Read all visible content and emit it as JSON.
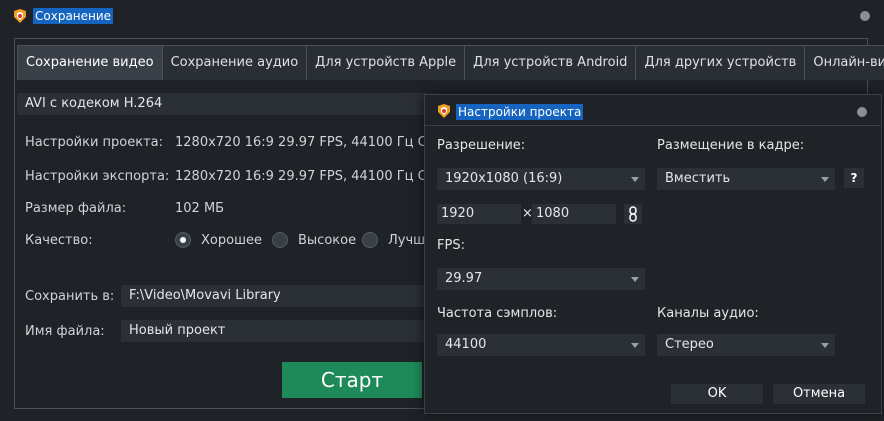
{
  "window": {
    "title": "Сохранение",
    "icon": "movavi-logo-icon"
  },
  "tabs": [
    {
      "label": "Сохранение видео",
      "active": true
    },
    {
      "label": "Сохранение аудио",
      "active": false
    },
    {
      "label": "Для устройств Apple",
      "active": false
    },
    {
      "label": "Для устройств Android",
      "active": false
    },
    {
      "label": "Для других устройств",
      "active": false
    },
    {
      "label": "Онлайн-видео",
      "active": false
    }
  ],
  "format": {
    "value": "AVI с кодеком H.264"
  },
  "rows": {
    "project_label": "Настройки проекта:",
    "project_value": "1280x720 16:9 29.97 FPS, 44100 Гц Ст",
    "export_label": "Настройки экспорта:",
    "export_value": "1280x720 16:9 29.97 FPS, 44100 Гц Ст",
    "size_label": "Размер файла:",
    "size_value": "102 МБ",
    "quality_label": "Качество:",
    "save_to_label": "Сохранить в:",
    "save_to_value": "F:\\Video\\Movavi Library",
    "filename_label": "Имя файла:",
    "filename_value": "Новый проект"
  },
  "quality_options": [
    {
      "label": "Хорошее",
      "selected": true
    },
    {
      "label": "Высокое",
      "selected": false
    },
    {
      "label": "Лучш",
      "selected": false
    }
  ],
  "start_label": "Старт",
  "dialog": {
    "title": "Настройки проекта",
    "resolution_label": "Разрешение:",
    "resolution_value": "1920x1080 (16:9)",
    "width_value": "1920",
    "times": "×",
    "height_value": "1080",
    "placement_label": "Размещение в кадре:",
    "placement_value": "Вместить",
    "help": "?",
    "fps_label": "FPS:",
    "fps_value": "29.97",
    "sample_label": "Частота сэмплов:",
    "sample_value": "44100",
    "channels_label": "Каналы аудио:",
    "channels_value": "Стерео",
    "ok_label": "OK",
    "cancel_label": "Отмена"
  },
  "colors": {
    "background": "#1f2328",
    "accent": "#1565c0",
    "start_button": "#1e8a5a"
  }
}
